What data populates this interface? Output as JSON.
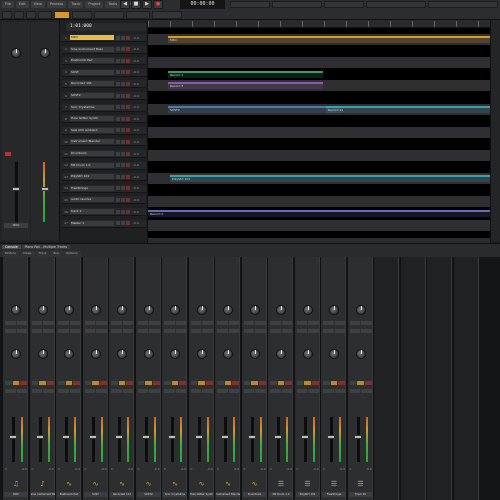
{
  "app": {
    "menu": [
      "File",
      "Edit",
      "View",
      "Process",
      "Track",
      "Project",
      "Tools",
      "Help"
    ],
    "time_display": "00:00:00",
    "bpm_display": "1:01:000"
  },
  "inspector": {
    "track_name": "MIDI"
  },
  "tracks": [
    {
      "num": "1",
      "name": "MIDI",
      "vol": "-0.0",
      "highlight": true
    },
    {
      "num": "2",
      "name": "Sine Instrument Bass",
      "vol": "-0.0"
    },
    {
      "num": "3",
      "name": "PostComb Pad",
      "vol": "-0.0"
    },
    {
      "num": "4",
      "name": "SUST",
      "vol": "-0.0"
    },
    {
      "num": "5",
      "name": "Recorded 101",
      "vol": "-0.0"
    },
    {
      "num": "6",
      "name": "SUST2",
      "vol": "-0.0"
    },
    {
      "num": "7",
      "name": "Scor Crystalline",
      "vol": "-0.0"
    },
    {
      "num": "8",
      "name": "Hole Glitter Synth",
      "vol": "-0.0"
    },
    {
      "num": "9",
      "name": "Saw Ahh Ambient",
      "vol": "-0.0"
    },
    {
      "num": "10",
      "name": "Instrument Blender",
      "vol": "-0.0"
    },
    {
      "num": "11",
      "name": "Drumtools",
      "vol": "-0.0"
    },
    {
      "num": "12",
      "name": "Mk Drum 1.0",
      "vol": "-0.0"
    },
    {
      "num": "13",
      "name": "PolyStrt 101",
      "vol": "-0.0"
    },
    {
      "num": "14",
      "name": "FreeStrings",
      "vol": "-0.0"
    },
    {
      "num": "15",
      "name": "audio revolve",
      "vol": "-0.0"
    },
    {
      "num": "16",
      "name": "track 2",
      "vol": "-0.0"
    },
    {
      "num": "17",
      "name": "Master 1",
      "vol": "-0.0"
    }
  ],
  "clips": [
    {
      "label": "MIDI",
      "color": "#d99a2a"
    },
    {
      "label": "Record 1",
      "color": "#3a9a6a"
    },
    {
      "label": "Record 3",
      "color": "#8a5ab0"
    },
    {
      "label": "SUST2",
      "color": "#4a7ab0"
    },
    {
      "label": "Record 11",
      "color": "#3aa0b0"
    },
    {
      "label": "PolyStrt 101",
      "color": "#3aa0b0"
    },
    {
      "label": "Record 2",
      "color": "#6a6ab8"
    }
  ],
  "console": {
    "tabs": [
      "Console",
      "Piano Roll - Multiple Tracks"
    ],
    "subtabs": [
      "Module",
      "Views",
      "Track",
      "Bus",
      "Options"
    ]
  },
  "channels": [
    {
      "name": "MIDI",
      "vol": "-0.0",
      "icon": "synth"
    },
    {
      "name": "Sine Instrument Bass",
      "vol": "-0.0",
      "icon": "guitar"
    },
    {
      "name": "PostComb Pad",
      "vol": "-0.0",
      "icon": "wave"
    },
    {
      "name": "SUST",
      "vol": "-0.0",
      "icon": "wave"
    },
    {
      "name": "Recorded 101",
      "vol": "-0.0",
      "icon": "wave"
    },
    {
      "name": "SUST2",
      "vol": "-0.0",
      "icon": "wave"
    },
    {
      "name": "Scor Crystalline",
      "vol": "-0.0",
      "icon": "wave"
    },
    {
      "name": "Hole Glitter Synth",
      "vol": "-0.0",
      "icon": "wave"
    },
    {
      "name": "Instrument Blender",
      "vol": "-0.0",
      "icon": "wave"
    },
    {
      "name": "Drumtools",
      "vol": "-0.0",
      "icon": "wave"
    },
    {
      "name": "Mk Drum 1.0",
      "vol": "-0.0",
      "icon": "keys"
    },
    {
      "name": "PolyStrt 101",
      "vol": "-0.0",
      "icon": "keys"
    },
    {
      "name": "FreeStrings",
      "vol": "-0.0",
      "icon": "keys"
    },
    {
      "name": "Track 16",
      "vol": "-0.0",
      "icon": "keys"
    }
  ],
  "colors": {
    "accent": "#d99a2a",
    "clip_lane": "#2f2f31"
  }
}
